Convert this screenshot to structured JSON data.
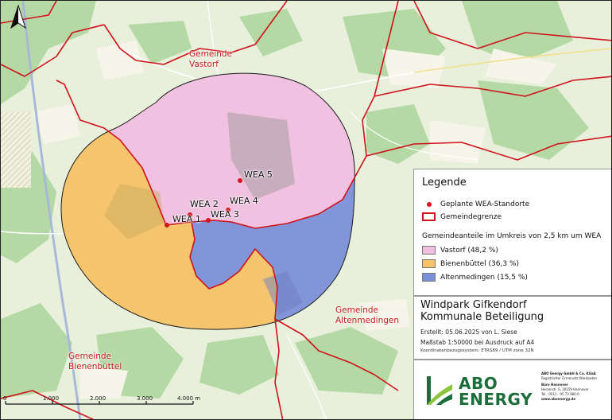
{
  "colors": {
    "vastorf": "#f0bedf",
    "bienenbuettel": "#f5c267",
    "altenmedingen": "#7d8fd8",
    "boundary": "#d0121a",
    "turbine": "#d6151b",
    "brand_green": "#1b6e3a"
  },
  "map": {
    "north_arrow_icon": "north-arrow",
    "turbines": [
      {
        "id": "wea1",
        "label": "WEA 1"
      },
      {
        "id": "wea2",
        "label": "WEA 2"
      },
      {
        "id": "wea3",
        "label": "WEA 3"
      },
      {
        "id": "wea4",
        "label": "WEA 4"
      },
      {
        "id": "wea5",
        "label": "WEA 5"
      }
    ],
    "municipalities": {
      "vastorf": [
        "Gemeinde",
        "Vastorf"
      ],
      "altenmedingen": [
        "Gemeinde",
        "Altenmedingen"
      ],
      "bienenbuettel": [
        "Gemeinde",
        "Bienenbüttel"
      ]
    },
    "scalebar": [
      "0",
      "1.000",
      "2.000",
      "3.000",
      "4.000 m"
    ]
  },
  "legend": {
    "title": "Legende",
    "planned": "Geplante WEA-Standorte",
    "boundary": "Gemeindegrenze",
    "section": "Gemeindeanteile im Umkreis von 2,5 km um WEA",
    "vastorf": "Vastorf (48,2 %)",
    "bienenbuettel": "Bienenbüttel (36,3 %)",
    "altenmedingen": "Altenmedingen (15,5 %)"
  },
  "shares": {
    "vastorf": 48.2,
    "bienenbuettel": 36.3,
    "altenmedingen": 15.5
  },
  "title_block": {
    "title1": "Windpark Gifkendorf",
    "title2": "Kommunale Beteiligung",
    "created": "Erstellt: 05.06.2025 von L. Siese",
    "scale": "Maßstab 1:50000  bei Ausdruck auf A4",
    "crs": "Koordinatenbezugssystem: ETRS89 / UTM zone 32N"
  },
  "logo": {
    "name": "ABO ENERGY",
    "company": "ABO Energy GmbH & Co. KGaA",
    "reg": "Registrierter Firmensitz Wiesbaden",
    "office": "Büro Hannover",
    "street": "Herrenstr. 6, 30159 Hannover",
    "phone": "Tel.: 0511 - 95 73 980-0",
    "web": "www.aboenergy.de"
  }
}
